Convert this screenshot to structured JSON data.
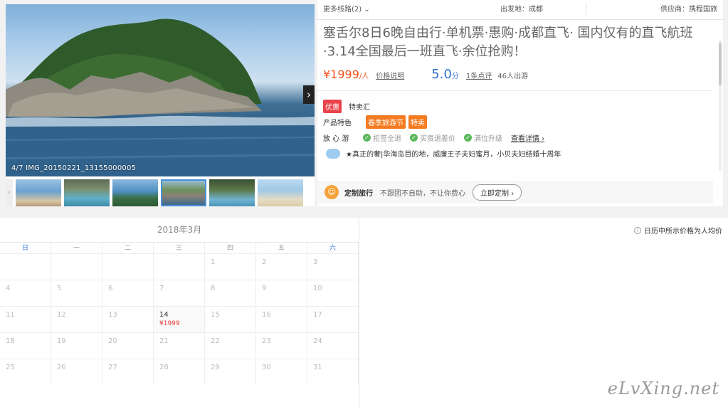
{
  "gallery": {
    "caption": "4/7 IMG_20150221_13155000005",
    "next_icon": "›",
    "thumb_nav_icon": "‹",
    "active_index": 3
  },
  "topbar": {
    "routes": "更多线路(2) ⌄",
    "departure": "出发地：成都",
    "supplier": "供应商：携程国旅"
  },
  "product": {
    "title": "塞舌尔8日6晚自由行·单机票·惠购·成都直飞· 国内仅有的直飞航班·3.14全国最后一班直飞·余位抢购！",
    "price": "¥1999",
    "price_unit": "/人",
    "price_link": "价格说明",
    "score": "5.0",
    "score_unit": "分",
    "review_link": "1条点评",
    "travelers": "46人出游"
  },
  "promo": {
    "badge": "优惠",
    "text": "特卖汇"
  },
  "features": {
    "label": "产品特色",
    "tags": [
      "春季旅游节",
      "特卖"
    ]
  },
  "assurance": {
    "label": "放 心 游",
    "items": [
      "拒签全退",
      "买贵退差价",
      "满位升级"
    ],
    "detail_link": "查看详情 ›"
  },
  "highlight": {
    "text": "★真正的奢|华海岛目的地，威廉王子夫妇蜜月，小贝夫妇结婚十周年"
  },
  "custom": {
    "icon": "☺",
    "title": "定制旅行",
    "desc": "不跟团不自助，不让你费心",
    "button": "立即定制 ›"
  },
  "calendar": {
    "month": "2018年3月",
    "weekdays": [
      "日",
      "一",
      "二",
      "三",
      "四",
      "五",
      "六"
    ],
    "cells": [
      {
        "d": ""
      },
      {
        "d": ""
      },
      {
        "d": ""
      },
      {
        "d": ""
      },
      {
        "d": "1"
      },
      {
        "d": "2"
      },
      {
        "d": "3"
      },
      {
        "d": "4"
      },
      {
        "d": "5"
      },
      {
        "d": "6"
      },
      {
        "d": "7"
      },
      {
        "d": "8"
      },
      {
        "d": "9"
      },
      {
        "d": "10"
      },
      {
        "d": "11"
      },
      {
        "d": "12"
      },
      {
        "d": "13"
      },
      {
        "d": "14",
        "price": "¥1999"
      },
      {
        "d": "15"
      },
      {
        "d": "16"
      },
      {
        "d": "17"
      },
      {
        "d": "18"
      },
      {
        "d": "19"
      },
      {
        "d": "20"
      },
      {
        "d": "21"
      },
      {
        "d": "22"
      },
      {
        "d": "23"
      },
      {
        "d": "24"
      },
      {
        "d": "25"
      },
      {
        "d": "26"
      },
      {
        "d": "27"
      },
      {
        "d": "28"
      },
      {
        "d": "29"
      },
      {
        "d": "30"
      },
      {
        "d": "31"
      }
    ],
    "note": "日历中所示价格为人均价"
  },
  "watermark": "eLvXing.net"
}
